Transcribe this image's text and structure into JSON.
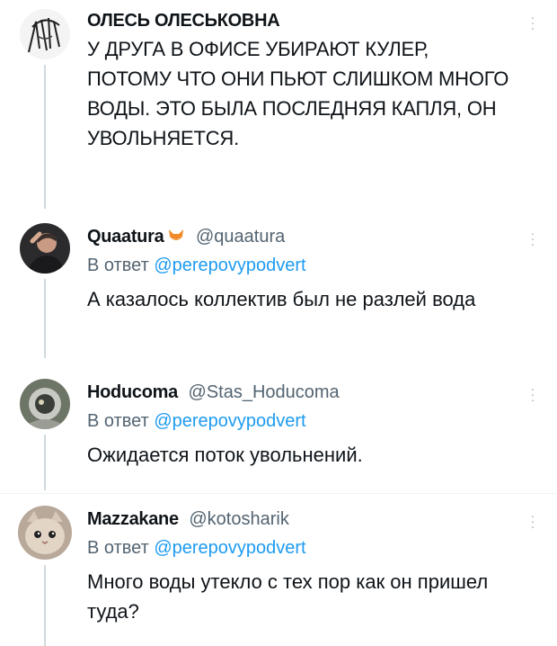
{
  "thread": [
    {
      "name": "ОЛЕСЬ ОЛЕСЬКОВНА",
      "handle": "",
      "reply_to_prefix": "",
      "reply_to_handle": "",
      "text": "У ДРУГА В ОФИСЕ УБИРАЮТ КУЛЕР, ПОТОМУ ЧТО ОНИ ПЬЮТ СЛИШКОМ МНОГО ВОДЫ. ЭТО БЫЛА ПОСЛЕДНЯЯ КАПЛЯ, ОН УВОЛЬНЯЕТСЯ.",
      "avatar_icon": "sketch-avatar-icon"
    },
    {
      "name": "Quaatura",
      "name_emoji": "fox-icon",
      "handle": "@quaatura",
      "reply_to_prefix": "В ответ ",
      "reply_to_handle": "@perepovypodvert",
      "text": "А казалось коллектив был не разлей вода",
      "avatar_icon": "person-avatar-icon"
    },
    {
      "name": "Hoducoma",
      "handle": "@Stas_Hoducoma",
      "reply_to_prefix": "В ответ ",
      "reply_to_handle": "@perepovypodvert",
      "text": "Ожидается поток увольнений.",
      "avatar_icon": "astronaut-avatar-icon"
    },
    {
      "name": "Mazzakane",
      "handle": "@kotosharik",
      "reply_to_prefix": "В ответ ",
      "reply_to_handle": "@perepovypodvert",
      "text": "Много воды утекло с тех пор как он пришел туда?",
      "avatar_icon": "cat-avatar-icon"
    }
  ],
  "more_icon": "more-options-icon",
  "colors": {
    "text": "#0f1419",
    "secondary": "#536471",
    "link": "#1d9bf0",
    "thread_line": "#cfd9de"
  }
}
